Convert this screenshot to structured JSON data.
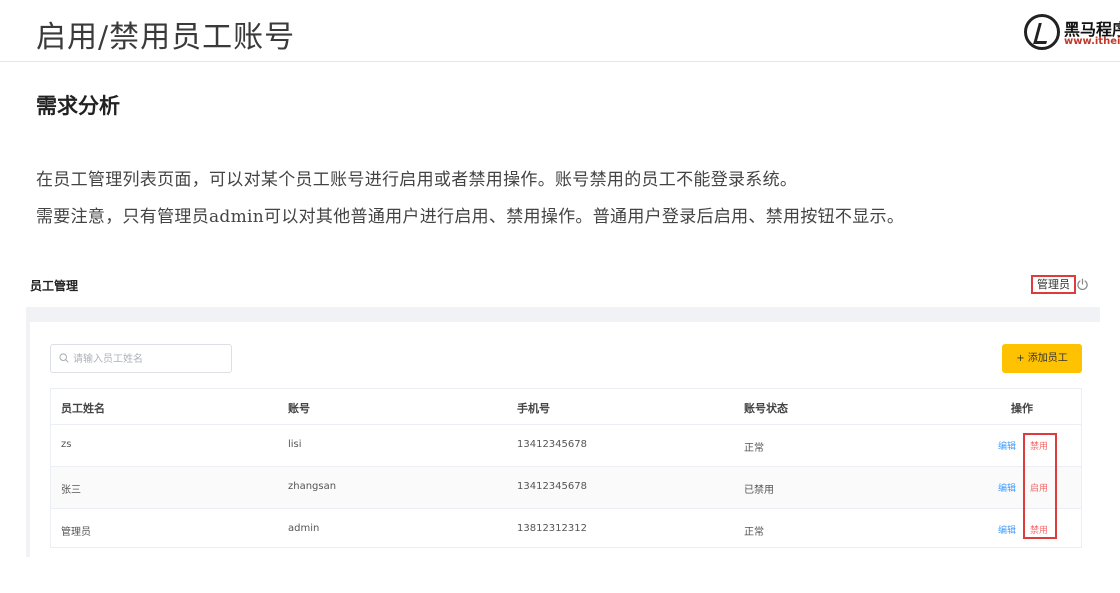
{
  "slide": {
    "title": "启用/禁用员工账号",
    "section_heading": "需求分析",
    "paragraphs": [
      "在员工管理列表页面，可以对某个员工账号进行启用或者禁用操作。账号禁用的员工不能登录系统。",
      "需要注意，只有管理员admin可以对其他普通用户进行启用、禁用操作。普通用户登录后启用、禁用按钮不显示。"
    ],
    "logo": {
      "name": "黑马程序员",
      "url": "www.itheima.com"
    }
  },
  "app": {
    "page_title": "员工管理",
    "user_label": "管理员",
    "power_icon": "power-icon",
    "search": {
      "placeholder": "请输入员工姓名",
      "value": ""
    },
    "add_button": "+ 添加员工",
    "colors": {
      "accent": "#ffc200",
      "link": "#419eff",
      "danger": "#f56c6c",
      "highlight": "#e03b3b"
    },
    "table": {
      "columns": [
        "员工姓名",
        "账号",
        "手机号",
        "账号状态",
        "操作"
      ],
      "rows": [
        {
          "name": "zs",
          "account": "lisi",
          "phone": "13412345678",
          "status": "正常",
          "edit": "编辑",
          "toggle": "禁用"
        },
        {
          "name": "张三",
          "account": "zhangsan",
          "phone": "13412345678",
          "status": "已禁用",
          "edit": "编辑",
          "toggle": "启用"
        },
        {
          "name": "管理员",
          "account": "admin",
          "phone": "13812312312",
          "status": "正常",
          "edit": "编辑",
          "toggle": "禁用"
        }
      ]
    }
  }
}
